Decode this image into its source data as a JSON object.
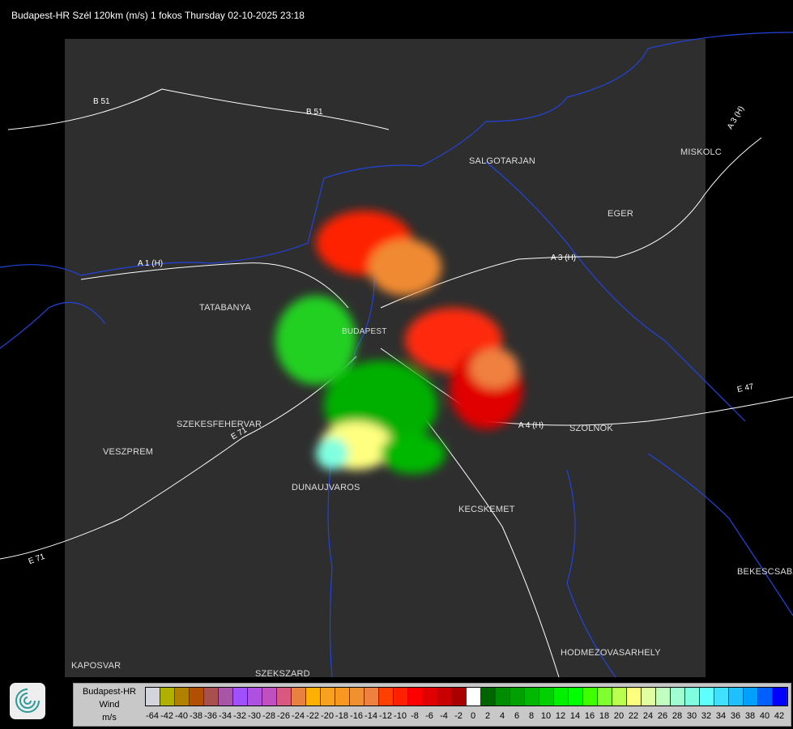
{
  "title": "Budapest-HR Szél 120km (m/s) 1 fokos Thursday 02-10-2025 23:18",
  "cities": [
    {
      "name": "SALGOTARJAN"
    },
    {
      "name": "EGER"
    },
    {
      "name": "MISKOLC"
    },
    {
      "name": "TATABANYA"
    },
    {
      "name": "SZEKESFEHERVAR"
    },
    {
      "name": "VESZPREM"
    },
    {
      "name": "DUNAUJVAROS"
    },
    {
      "name": "KECSKEMET"
    },
    {
      "name": "SZOLNOK"
    },
    {
      "name": "BEKESCSABA"
    },
    {
      "name": "HODMEZOVASARHELY"
    },
    {
      "name": "KAPOSVAR"
    },
    {
      "name": "SZEKSZARD"
    },
    {
      "name": "BUDAPEST"
    }
  ],
  "roads": [
    "B 51",
    "B 51",
    "A 1 (H)",
    "A 3 (H)",
    "A 3 (H)",
    "A 4 (H)",
    "E 47",
    "E 71",
    "E 71"
  ],
  "legend": {
    "station": "Budapest-HR",
    "quantity": "Wind",
    "unit": "m/s",
    "labels": [
      "-64",
      "-42",
      "-40",
      "-38",
      "-36",
      "-34",
      "-32",
      "-30",
      "-28",
      "-26",
      "-24",
      "-22",
      "-20",
      "-18",
      "-16",
      "-14",
      "-12",
      "-10",
      "-8",
      "-6",
      "-4",
      "-2",
      "0",
      "2",
      "4",
      "6",
      "8",
      "10",
      "12",
      "14",
      "16",
      "18",
      "20",
      "22",
      "24",
      "26",
      "28",
      "30",
      "32",
      "34",
      "36",
      "38",
      "40",
      "42"
    ],
    "colors": [
      "#d4d4dc",
      "#b0b000",
      "#b08000",
      "#b05000",
      "#a85050",
      "#a855a8",
      "#a050ff",
      "#b050e0",
      "#c050c0",
      "#d85880",
      "#e88040",
      "#ffb000",
      "#f8a020",
      "#f89820",
      "#f09030",
      "#f08040",
      "#ff4000",
      "#ff2000",
      "#ff0000",
      "#e00000",
      "#c80000",
      "#a80000",
      "#ffffff",
      "#006400",
      "#008c00",
      "#00a000",
      "#00b800",
      "#00d000",
      "#00f000",
      "#00ff00",
      "#40ff00",
      "#80ff30",
      "#b8ff50",
      "#ffff80",
      "#e0ffa0",
      "#c0ffc0",
      "#a0ffd0",
      "#80ffe0",
      "#60ffff",
      "#40e0ff",
      "#20c0ff",
      "#00a0ff",
      "#0060ff",
      "#0000ff"
    ]
  }
}
